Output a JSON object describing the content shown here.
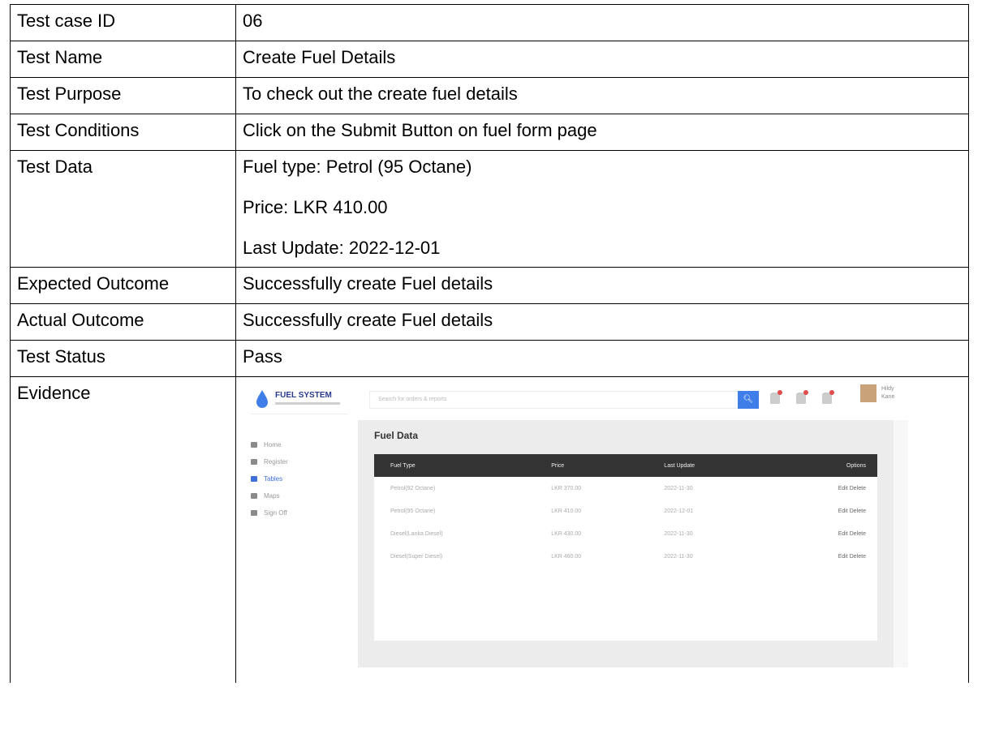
{
  "rows": [
    {
      "label": "Test case ID",
      "value": "06"
    },
    {
      "label": "Test Name",
      "value": "Create Fuel Details"
    },
    {
      "label": "Test Purpose",
      "value": "To check out the create fuel details"
    },
    {
      "label": "Test Conditions",
      "value": "Click on the Submit Button on fuel form page"
    },
    {
      "label": "Test Data",
      "lines": [
        "Fuel type: Petrol (95 Octane)",
        "Price: LKR 410.00",
        "Last Update: 2022-12-01"
      ]
    },
    {
      "label": "Expected Outcome",
      "value": "Successfully create Fuel details"
    },
    {
      "label": "Actual Outcome",
      "value": "Successfully create Fuel details"
    },
    {
      "label": "Test Status",
      "value": "Pass"
    },
    {
      "label": "Evidence"
    }
  ],
  "evidence": {
    "app_title": "FUEL SYSTEM",
    "search_placeholder": "Search for orders & reports",
    "search_icon": "search-icon",
    "user_name": "Hildy",
    "user_role": "Kane",
    "nav": [
      "Home",
      "Register",
      "Tables",
      "Maps",
      "Sign Off"
    ],
    "active_nav": "Tables",
    "page_heading": "Fuel Data",
    "table_headers": [
      "Fuel Type",
      "Price",
      "Last Update",
      "Options"
    ],
    "table_rows": [
      [
        "Petrol(92 Octane)",
        "LKR 370.00",
        "2022-11-30",
        "Edit Delete"
      ],
      [
        "Petrol(95 Octane)",
        "LKR 410.00",
        "2022-12-01",
        "Edit Delete"
      ],
      [
        "Diesel(Lanka Diesel)",
        "LKR 430.00",
        "2022-11-30",
        "Edit Delete"
      ],
      [
        "Diesel(Super Diesel)",
        "LKR 460.00",
        "2022-11-30",
        "Edit Delete"
      ]
    ],
    "colors": {
      "accent": "#3f7ee8",
      "header_bg": "#333333",
      "content_bg": "#ececec"
    }
  }
}
